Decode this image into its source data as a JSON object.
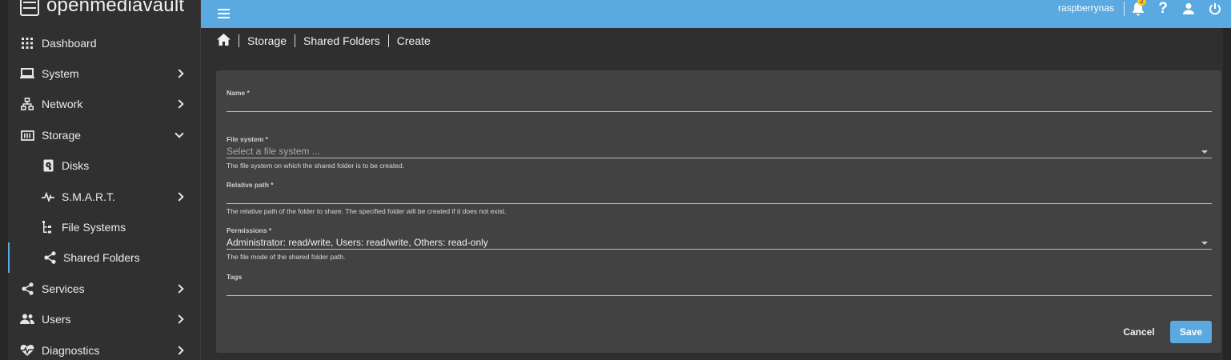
{
  "app": {
    "brand": "openmediavault",
    "accent": "#5aa9e0"
  },
  "header": {
    "hostname": "raspberrynas",
    "notification_count": "2"
  },
  "sidebar": {
    "items": [
      {
        "label": "Dashboard",
        "icon": "grid-icon"
      },
      {
        "label": "System",
        "icon": "laptop-icon"
      },
      {
        "label": "Network",
        "icon": "network-icon"
      },
      {
        "label": "Storage",
        "icon": "storage-icon"
      },
      {
        "label": "Disks",
        "icon": "disk-icon"
      },
      {
        "label": "S.M.A.R.T.",
        "icon": "pulse-icon"
      },
      {
        "label": "File Systems",
        "icon": "tree-icon"
      },
      {
        "label": "Shared Folders",
        "icon": "share-icon"
      },
      {
        "label": "Services",
        "icon": "share-icon"
      },
      {
        "label": "Users",
        "icon": "users-icon"
      },
      {
        "label": "Diagnostics",
        "icon": "heartbeat-icon"
      }
    ]
  },
  "breadcrumb": {
    "items": [
      "Storage",
      "Shared Folders",
      "Create"
    ]
  },
  "form": {
    "name": {
      "label": "Name *",
      "value": ""
    },
    "filesystem": {
      "label": "File system *",
      "placeholder": "Select a file system ...",
      "hint": "The file system on which the shared folder is to be created."
    },
    "relpath": {
      "label": "Relative path *",
      "value": "",
      "hint": "The relative path of the folder to share. The specified folder will be created if it does not exist."
    },
    "permissions": {
      "label": "Permissions *",
      "value": "Administrator: read/write, Users: read/write, Others: read-only",
      "hint": "The file mode of the shared folder path."
    },
    "tags": {
      "label": "Tags",
      "value": ""
    },
    "cancel_label": "Cancel",
    "save_label": "Save"
  }
}
